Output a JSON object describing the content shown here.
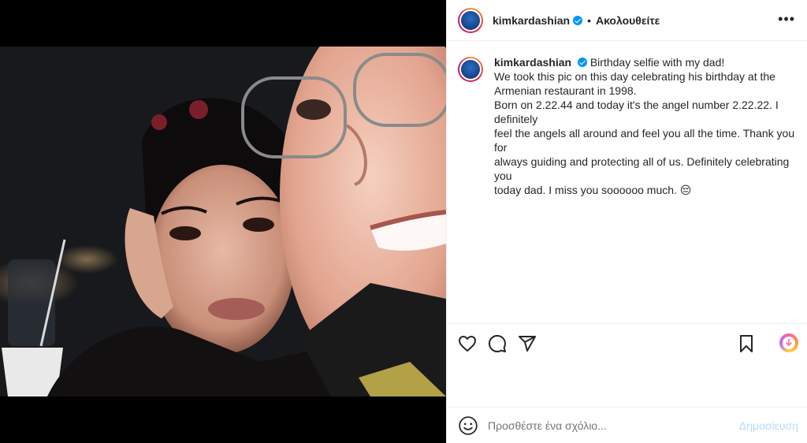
{
  "post": {
    "author": "kimkardashian",
    "verified": true,
    "dot": "•",
    "follow_label": "Ακολουθείτε",
    "more_label": "•••",
    "media": {
      "description_icon": "photo"
    }
  },
  "caption": {
    "author": "kimkardashian",
    "lines": [
      "Birthday selfie with my dad!",
      "We took this pic on this day celebrating his birthday at the",
      "Armenian restaurant in 1998.",
      "Born on 2.22.44 and today it's the angel number 2.22.22. I definitely",
      "feel the angels all around and feel you all the time. Thank you for",
      "always guiding and protecting all of us. Definitely celebrating you",
      "today dad. I miss you soooooo much. 😔"
    ]
  },
  "actions": {
    "like_icon": "heart-icon",
    "comment_icon": "comment-icon",
    "share_icon": "share-icon",
    "save_icon": "bookmark-icon",
    "download_icon": "download-icon"
  },
  "comment": {
    "placeholder": "Προσθέστε ένα σχόλιο...",
    "post_label": "Δημοσίευση"
  },
  "colors": {
    "accent": "#0095f6",
    "post_disabled": "#b3dbff",
    "text": "#262626",
    "muted": "#8e8e8e",
    "divider": "#efefef"
  }
}
